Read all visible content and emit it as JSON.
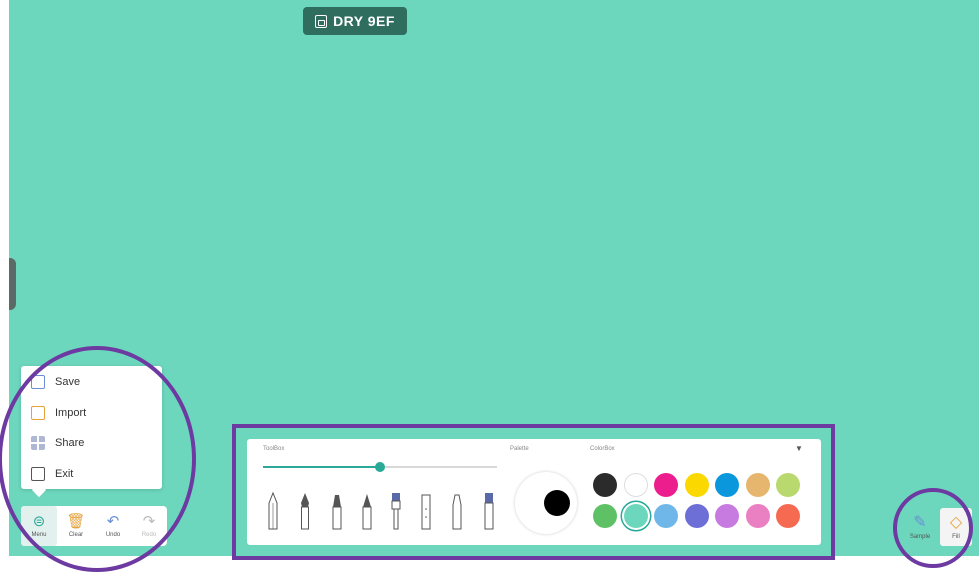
{
  "room": {
    "code": "DRY 9EF",
    "icon": "whiteboard-icon"
  },
  "menu": {
    "items": [
      {
        "label": "Save",
        "icon": "save-icon"
      },
      {
        "label": "Import",
        "icon": "import-icon"
      },
      {
        "label": "Share",
        "icon": "share-icon"
      },
      {
        "label": "Exit",
        "icon": "exit-icon"
      }
    ]
  },
  "toolbar": {
    "menu_label": "Menu",
    "clear_label": "Clear",
    "undo_label": "Undo",
    "redo_label": "Redo"
  },
  "toolbox": {
    "label": "ToolBox",
    "stroke_size_fraction": 0.5,
    "tools": [
      "pencil-icon",
      "fountain-pen-icon",
      "marker-icon",
      "crayon-icon",
      "brush-icon",
      "chalk-icon",
      "highlighter-icon",
      "eraser-pen-icon"
    ]
  },
  "palette": {
    "label": "Palette",
    "current_color": "#000000"
  },
  "colorbox": {
    "label": "ColorBox",
    "selected": "#6cd7bd",
    "colors": [
      "#2b2b2b",
      "#ffffff",
      "#ec1d8c",
      "#fbd800",
      "#0a97dc",
      "#e6b66e",
      "#b9d86e",
      "#5ec165",
      "#6cd7bd",
      "#6fb7e8",
      "#6e6fd6",
      "#c77be0",
      "#ea7fc1",
      "#f66a52"
    ]
  },
  "right_tools": {
    "sample_label": "Sample",
    "fill_label": "Fill"
  },
  "colors": {
    "canvas": "#6cd7bd",
    "accent": "#2aa998",
    "annotation": "#6c3aa0"
  }
}
